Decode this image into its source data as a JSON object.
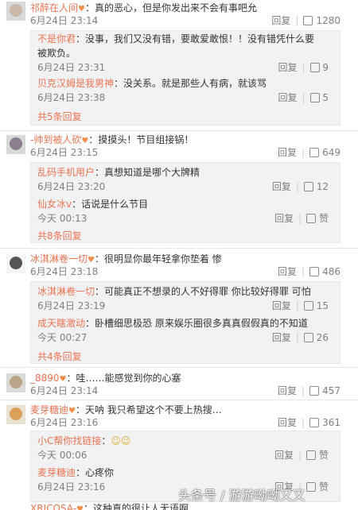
{
  "comments": [
    {
      "user": "祁醉在人间",
      "text": "：真的恶心，但是你发出来不会有事吧允",
      "time": "6月24日 23:14",
      "reply_label": "回复",
      "like_count": "1280",
      "replies": [
        {
          "user": "不是你君",
          "text": "：没事，我们又没有错，要敢爱敢恨！！没有错凭什么要",
          "text2": "被欺负。",
          "time": "6月24日 23:31",
          "reply_label": "回复",
          "like_count": "9"
        },
        {
          "user": "贝克汉姆是我男神",
          "text": "：没关系。就是那些人有病，就该骂",
          "time": "6月24日 23:38",
          "reply_label": "回复",
          "like_count": "5"
        }
      ],
      "more": "共5条回复"
    },
    {
      "user": "-帅到被人砍",
      "text": "：摸摸头！节目组接锅！",
      "time": "6月24日 23:15",
      "reply_label": "回复",
      "like_count": "649",
      "replies": [
        {
          "user": "乱码手机用户",
          "text": "：真想知道是哪个大牌精",
          "time": "6月24日 23:20",
          "reply_label": "回复",
          "like_count": "12"
        },
        {
          "user": "仙女冰v",
          "text": "：话说是什么节目",
          "time": "今天 00:13",
          "reply_label": "回复",
          "like_count": "赞"
        }
      ],
      "more": "共8条回复"
    },
    {
      "user": "冰淇淋卷一切",
      "text": "：很明显你最年轻拿你垫着 惨",
      "time": "6月24日 23:18",
      "reply_label": "回复",
      "like_count": "486",
      "replies": [
        {
          "user": "冰淇淋卷一切",
          "text": "：可能真正不想录的人不好得罪 你比较好得罪 可怕",
          "time": "6月24日 23:19",
          "reply_label": "回复",
          "like_count": "15"
        },
        {
          "user": "成天瞎激动",
          "text": "：卧槽细思极恐 原来娱乐圈很多真真假假真的不知道",
          "time": "今天 00:27",
          "reply_label": "回复",
          "like_count": "26"
        }
      ],
      "more": "共4条回复"
    },
    {
      "user": "_8890",
      "text": "：哇……能感觉到你的心塞",
      "time": "6月24日 23:14",
      "reply_label": "回复",
      "like_count": "457",
      "replies": [],
      "more": ""
    },
    {
      "user": "麦芽糖迪",
      "text": "：天呐 我只希望这个不要上热搜…",
      "time": "6月24日 23:16",
      "reply_label": "回复",
      "like_count": "361",
      "replies": [
        {
          "user": "小C帮你找链接",
          "text": "：",
          "time": "今天 00:06",
          "reply_label": "回复",
          "like_count": "赞"
        },
        {
          "user": "麦芽糖迪",
          "text": "：心疼你",
          "time": "6月24日 23:16",
          "reply_label": "回复",
          "like_count": "赞"
        }
      ],
      "more": ""
    },
    {
      "user": "XRICOSA-",
      "text": "：这种真的很让人无语啊",
      "time": "",
      "reply_label": "",
      "like_count": "",
      "replies": [],
      "more": ""
    }
  ],
  "watermark": "头条号 / 游游呦呦又又",
  "colors": {
    "username": "#eb7350",
    "meta": "#808080",
    "reply_bg": "#f2f2f5"
  }
}
